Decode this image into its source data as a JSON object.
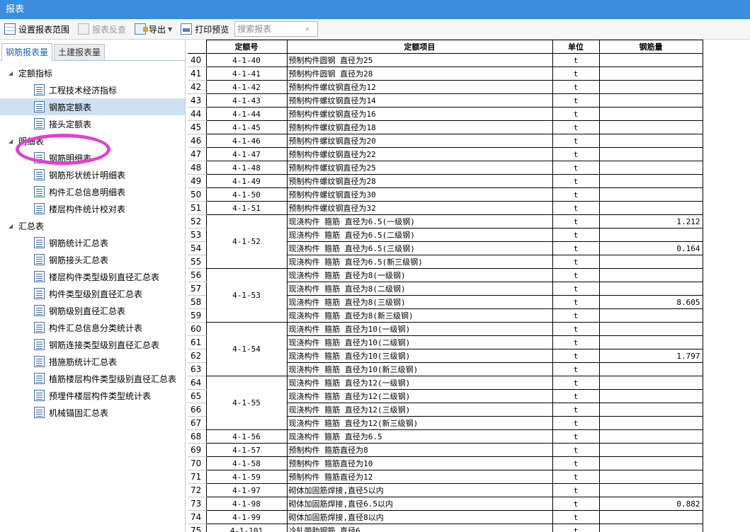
{
  "window": {
    "title": "报表"
  },
  "toolbar": {
    "set_range": "设置报表范围",
    "reverse": "报表反查",
    "export": "导出",
    "print_preview": "打印预览",
    "search_placeholder": "搜索报表"
  },
  "tabs": [
    {
      "label": "钢筋报表量",
      "active": true
    },
    {
      "label": "土建报表量",
      "active": false
    }
  ],
  "tree": {
    "groups": [
      {
        "label": "定额指标",
        "items": [
          "工程技术经济指标",
          "钢筋定额表",
          "接头定额表"
        ]
      },
      {
        "label": "明细表",
        "items": [
          "钢筋明细表",
          "钢筋形状统计明细表",
          "构件汇总信息明细表",
          "楼层构件统计校对表"
        ]
      },
      {
        "label": "汇总表",
        "items": [
          "钢筋统计汇总表",
          "钢筋接头汇总表",
          "楼层构件类型级别直径汇总表",
          "构件类型级别直径汇总表",
          "钢筋级别直径汇总表",
          "构件汇总信息分类统计表",
          "钢筋连接类型级别直径汇总表",
          "措施筋统计汇总表",
          "植筋楼层构件类型级别直径汇总表",
          "预埋件楼层构件类型统计表",
          "机械锚固汇总表"
        ]
      }
    ],
    "selected": "钢筋定额表"
  },
  "table": {
    "headers": [
      "定额号",
      "定额项目",
      "单位",
      "钢筋量"
    ],
    "rows": [
      {
        "n": "40",
        "code": "4-1-40",
        "item": "预制构件圆钢 直径为25",
        "unit": "t",
        "qty": ""
      },
      {
        "n": "41",
        "code": "4-1-41",
        "item": "预制构件圆钢 直径为28",
        "unit": "t",
        "qty": ""
      },
      {
        "n": "42",
        "code": "4-1-42",
        "item": "预制构件螺纹钢直径为12",
        "unit": "t",
        "qty": ""
      },
      {
        "n": "43",
        "code": "4-1-43",
        "item": "预制构件螺纹钢直径为14",
        "unit": "t",
        "qty": ""
      },
      {
        "n": "44",
        "code": "4-1-44",
        "item": "预制构件螺纹钢直径为16",
        "unit": "t",
        "qty": ""
      },
      {
        "n": "45",
        "code": "4-1-45",
        "item": "预制构件螺纹钢直径为18",
        "unit": "t",
        "qty": ""
      },
      {
        "n": "46",
        "code": "4-1-46",
        "item": "预制构件螺纹钢直径为20",
        "unit": "t",
        "qty": ""
      },
      {
        "n": "47",
        "code": "4-1-47",
        "item": "预制构件螺纹钢直径为22",
        "unit": "t",
        "qty": ""
      },
      {
        "n": "48",
        "code": "4-1-48",
        "item": "预制构件螺纹钢直径为25",
        "unit": "t",
        "qty": ""
      },
      {
        "n": "49",
        "code": "4-1-49",
        "item": "预制构件螺纹钢直径为28",
        "unit": "t",
        "qty": ""
      },
      {
        "n": "50",
        "code": "4-1-50",
        "item": "预制构件螺纹钢直径为30",
        "unit": "t",
        "qty": ""
      },
      {
        "n": "51",
        "code": "4-1-51",
        "item": "预制构件螺纹钢直径为32",
        "unit": "t",
        "qty": ""
      },
      {
        "n": "52",
        "code": "4-1-52",
        "span": 4,
        "item": "现浇构件 箍筋 直径为6.5(一级钢)",
        "unit": "t",
        "qty": "1.212"
      },
      {
        "n": "53",
        "item": "现浇构件 箍筋 直径为6.5(二级钢)",
        "unit": "t",
        "qty": ""
      },
      {
        "n": "54",
        "item": "现浇构件 箍筋 直径为6.5(三级钢)",
        "unit": "t",
        "qty": "0.164"
      },
      {
        "n": "55",
        "item": "现浇构件 箍筋 直径为6.5(新三级钢)",
        "unit": "t",
        "qty": ""
      },
      {
        "n": "56",
        "code": "4-1-53",
        "span": 4,
        "item": "现浇构件 箍筋 直径为8(一级钢)",
        "unit": "t",
        "qty": ""
      },
      {
        "n": "57",
        "item": "现浇构件 箍筋 直径为8(二级钢)",
        "unit": "t",
        "qty": ""
      },
      {
        "n": "58",
        "item": "现浇构件 箍筋 直径为8(三级钢)",
        "unit": "t",
        "qty": "8.605"
      },
      {
        "n": "59",
        "item": "现浇构件 箍筋 直径为8(新三级钢)",
        "unit": "t",
        "qty": ""
      },
      {
        "n": "60",
        "code": "4-1-54",
        "span": 4,
        "item": "现浇构件 箍筋 直径为10(一级钢)",
        "unit": "t",
        "qty": ""
      },
      {
        "n": "61",
        "item": "现浇构件 箍筋 直径为10(二级钢)",
        "unit": "t",
        "qty": ""
      },
      {
        "n": "62",
        "item": "现浇构件 箍筋 直径为10(三级钢)",
        "unit": "t",
        "qty": "1.797"
      },
      {
        "n": "63",
        "item": "现浇构件 箍筋 直径为10(新三级钢)",
        "unit": "t",
        "qty": ""
      },
      {
        "n": "64",
        "code": "4-1-55",
        "span": 4,
        "item": "现浇构件 箍筋 直径为12(一级钢)",
        "unit": "t",
        "qty": ""
      },
      {
        "n": "65",
        "item": "现浇构件 箍筋 直径为12(二级钢)",
        "unit": "t",
        "qty": ""
      },
      {
        "n": "66",
        "item": "现浇构件 箍筋 直径为12(三级钢)",
        "unit": "t",
        "qty": ""
      },
      {
        "n": "67",
        "item": "现浇构件 箍筋 直径为12(新三级钢)",
        "unit": "t",
        "qty": ""
      },
      {
        "n": "68",
        "code": "4-1-56",
        "item": "现浇构件 箍筋 直径为6.5",
        "unit": "t",
        "qty": ""
      },
      {
        "n": "69",
        "code": "4-1-57",
        "item": "预制构件 箍筋直径为8",
        "unit": "t",
        "qty": ""
      },
      {
        "n": "70",
        "code": "4-1-58",
        "item": "预制构件 箍筋直径为10",
        "unit": "t",
        "qty": ""
      },
      {
        "n": "71",
        "code": "4-1-59",
        "item": "预制构件 箍筋直径为12",
        "unit": "t",
        "qty": ""
      },
      {
        "n": "72",
        "code": "4-1-97",
        "item": "砌体加固筋焊接,直径5以内",
        "unit": "t",
        "qty": ""
      },
      {
        "n": "73",
        "code": "4-1-98",
        "item": "砌体加固筋焊接,直径6.5以内",
        "unit": "t",
        "qty": "0.882"
      },
      {
        "n": "74",
        "code": "4-1-99",
        "item": "砌体加固筋焊接,直径8以内",
        "unit": "t",
        "qty": ""
      },
      {
        "n": "75",
        "code": "4-1-101",
        "item": "冷轧带肋钢筋 直径6",
        "unit": "t",
        "qty": ""
      }
    ]
  },
  "colors": {
    "titlebar": "#3c8dde",
    "highlight": "#e63ed0",
    "selected_row": "#cfe0f3"
  }
}
